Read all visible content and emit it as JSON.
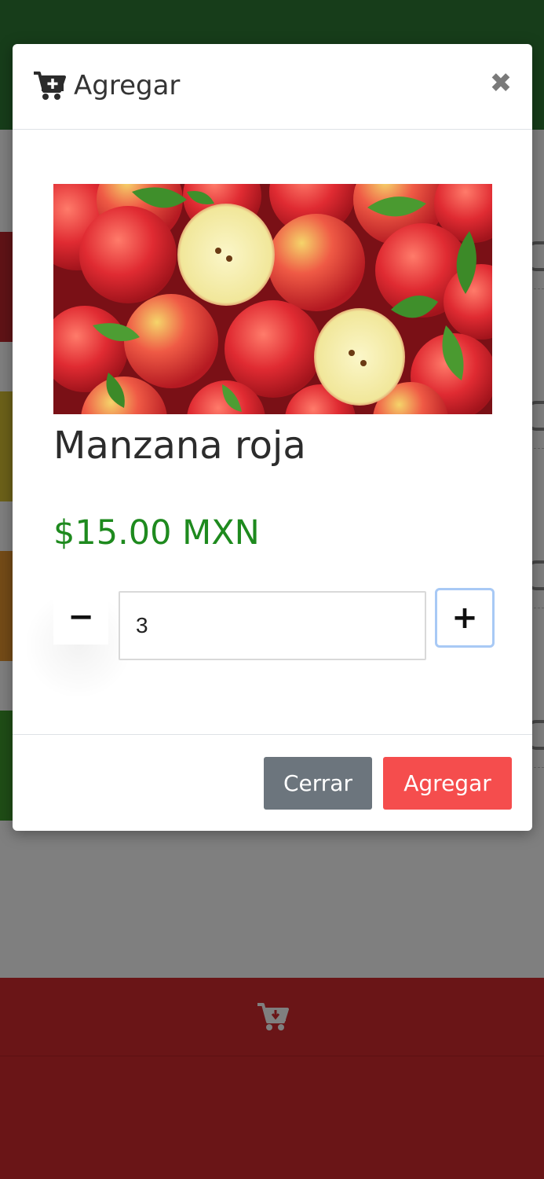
{
  "modal": {
    "title": "Agregar",
    "close_icon": "close-icon",
    "header_icon": "cart-plus-icon",
    "product": {
      "name": "Manzana roja",
      "price": "$15.00 MXN",
      "image": "red-apples-photo"
    },
    "quantity": {
      "value": "3",
      "minus_label": "−",
      "plus_label": "+"
    },
    "footer": {
      "close_label": "Cerrar",
      "add_label": "Agregar"
    }
  },
  "bottom_bar": {
    "cart_icon": "cart-download-icon"
  },
  "colors": {
    "header_green": "#2f7a34",
    "bottom_red": "#d42a2f",
    "price_green": "#1e8a1e",
    "add_button": "#f54d4d",
    "close_button": "#6c757d"
  }
}
